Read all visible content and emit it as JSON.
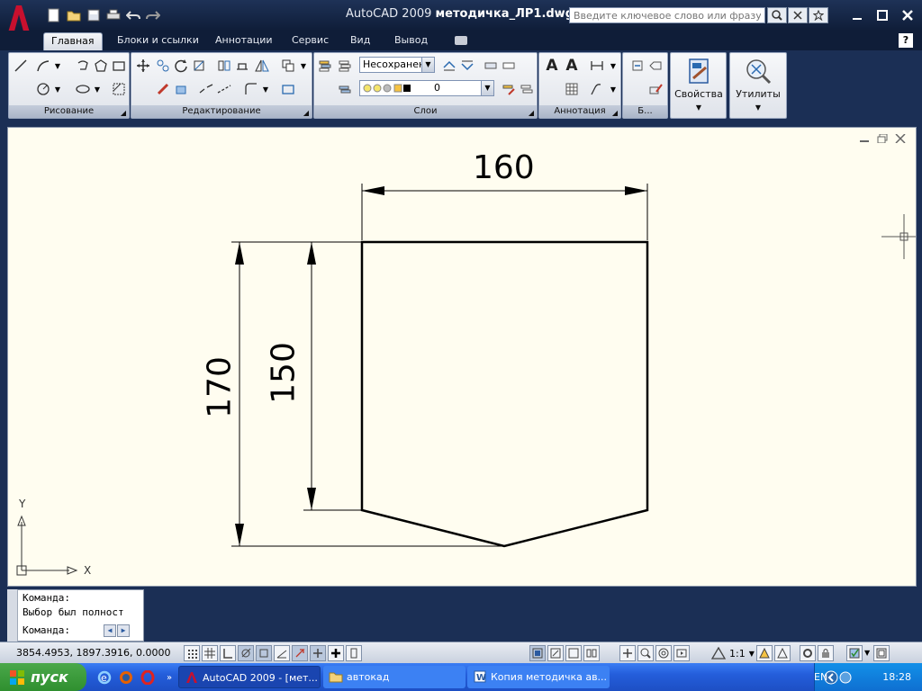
{
  "titlebar": {
    "app": "AutoCAD 2009",
    "file": "методичка_ЛР1.dwg",
    "search_placeholder": "Введите ключевое слово или фразу"
  },
  "tabs": [
    {
      "label": "Главная",
      "active": true
    },
    {
      "label": "Блоки и ссылки"
    },
    {
      "label": "Аннотации"
    },
    {
      "label": "Сервис"
    },
    {
      "label": "Вид"
    },
    {
      "label": "Вывод"
    }
  ],
  "help_label": "?",
  "panels": {
    "draw": "Рисование",
    "modify": "Редактирование",
    "layers": "Слои",
    "annotation": "Аннотация",
    "blocks": "Б...",
    "properties": "Свойства",
    "utilities": "Утилиты"
  },
  "layers": {
    "state_combo": "Несохранен",
    "layer_combo": "0"
  },
  "drawing": {
    "dim_width": "160",
    "dim_total_height": "170",
    "dim_side_height": "150",
    "axis_y": "Y",
    "axis_x": "X"
  },
  "command": {
    "line1": "Команда:",
    "line2": "Выбор был полност",
    "prompt": "Команда:"
  },
  "status": {
    "coords": "3854.4953, 1897.3916, 0.0000",
    "scale": "1:1"
  },
  "taskbar": {
    "start": "пуск",
    "tasks": [
      "AutoCAD 2009 - [мет...",
      "автокад",
      "Копия методичка ав..."
    ],
    "lang": "EN",
    "time": "18:28"
  },
  "colors": {
    "ribbon_bg": "#1b2f55",
    "canvas_bg": "#fffdf0",
    "taskbar": "#245edb",
    "start": "#2f8f2f"
  }
}
